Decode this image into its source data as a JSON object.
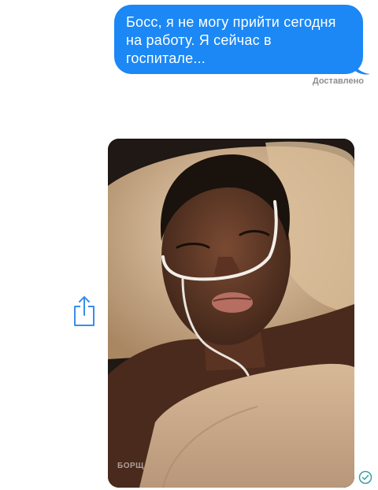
{
  "message": {
    "text": "Босс, я не могу прийти сегодня на работу. Я сейчас в госпитале...",
    "status": "Доставлено",
    "accent_color": "#1b88f5"
  },
  "photo": {
    "watermark": "БОРЩ"
  },
  "icons": {
    "share": "share-icon",
    "delivered_check": "check-circle-icon"
  }
}
